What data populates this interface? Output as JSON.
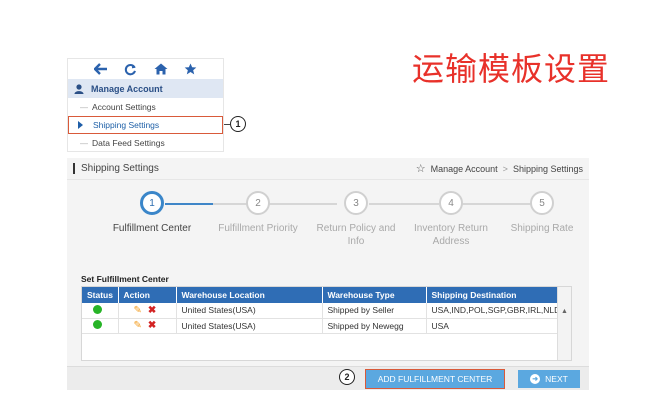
{
  "annotation_title": "运输模板设置",
  "menu": {
    "icons": [
      "back-arrow-icon",
      "refresh-icon",
      "home-icon",
      "star-icon"
    ],
    "section_title": "Manage Account",
    "items": [
      {
        "label": "Account Settings",
        "active": false
      },
      {
        "label": "Shipping Settings",
        "active": true
      },
      {
        "label": "Data Feed Settings",
        "active": false
      }
    ]
  },
  "callouts": {
    "one": "1",
    "two": "2"
  },
  "page": {
    "title": "Shipping Settings",
    "breadcrumb": [
      "Manage Account",
      "Shipping Settings"
    ],
    "breadcrumb_separator": ">"
  },
  "steps": [
    {
      "number": "1",
      "label": "Fulfillment Center",
      "current": true
    },
    {
      "number": "2",
      "label": "Fulfillment Priority",
      "current": false
    },
    {
      "number": "3",
      "label": "Return Policy and Info",
      "current": false
    },
    {
      "number": "4",
      "label": "Inventory Return Address",
      "current": false
    },
    {
      "number": "5",
      "label": "Shipping Rate",
      "current": false
    }
  ],
  "section_title": "Set Fulfillment Center",
  "table": {
    "columns": [
      "Status",
      "Action",
      "Warehouse Location",
      "Warehouse Type",
      "Shipping Destination"
    ],
    "rows": [
      {
        "location": "United States(USA)",
        "type": "Shipped by Seller",
        "destination": "USA,IND,POL,SGP,GBR,IRL,NLD"
      },
      {
        "location": "United States(USA)",
        "type": "Shipped by Newegg",
        "destination": "USA"
      }
    ]
  },
  "buttons": {
    "add": "ADD FULFILLMENT CENTER",
    "next": "NEXT"
  },
  "colors": {
    "accent": "#2f6db5",
    "button": "#5ba8e0",
    "annotation_red": "#e8312a",
    "status_green": "#27b427"
  }
}
